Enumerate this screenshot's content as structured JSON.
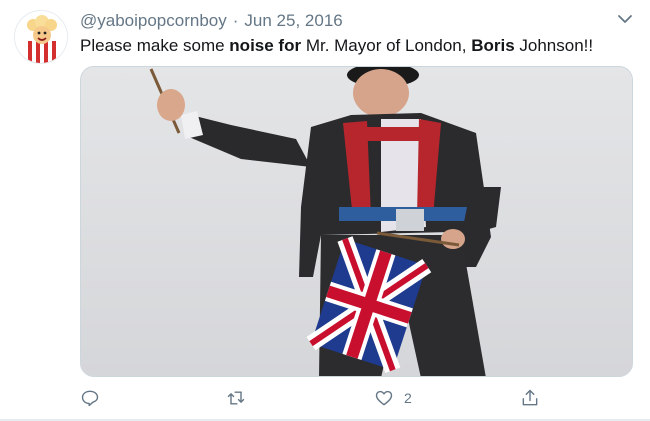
{
  "tweet": {
    "handle": "@yaboipopcornboy",
    "separator": "·",
    "date": "Jun 25, 2016",
    "text_parts": [
      "Please make some ",
      "noise for",
      " Mr. Mayor of London, ",
      "Boris",
      " Johnson!!"
    ],
    "likes": "2"
  },
  "icons": {
    "caret": "chevron-down-icon",
    "reply": "reply-icon",
    "retweet": "retweet-icon",
    "like": "heart-icon",
    "share": "share-icon"
  },
  "colors": {
    "text": "#14171a",
    "muted": "#657786",
    "border": "#e6ecf0",
    "flag_blue": "#1f3b8f",
    "flag_red": "#c8102e"
  }
}
